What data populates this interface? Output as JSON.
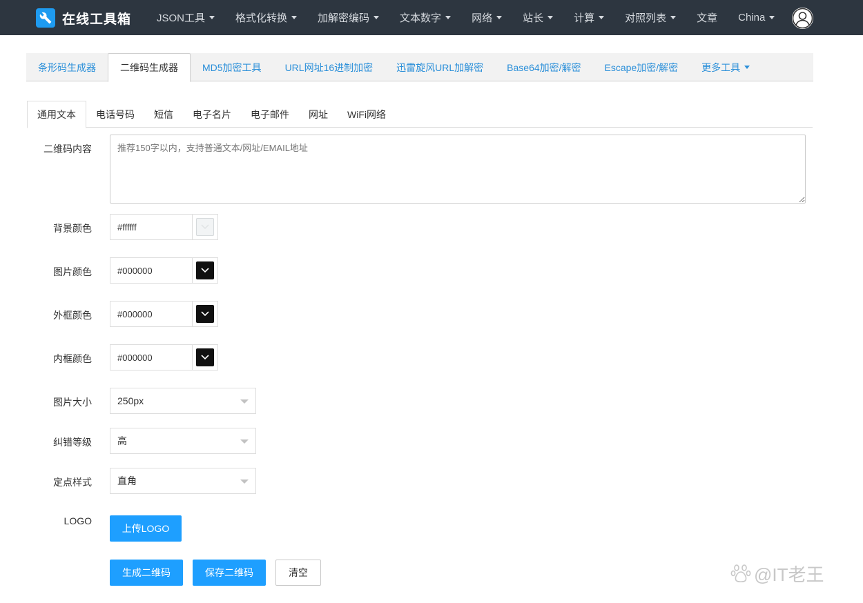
{
  "navbar": {
    "brand": "在线工具箱",
    "items": [
      {
        "label": "JSON工具",
        "dropdown": true
      },
      {
        "label": "格式化转换",
        "dropdown": true
      },
      {
        "label": "加解密编码",
        "dropdown": true
      },
      {
        "label": "文本数字",
        "dropdown": true
      },
      {
        "label": "网络",
        "dropdown": true
      },
      {
        "label": "站长",
        "dropdown": true
      },
      {
        "label": "计算",
        "dropdown": true
      },
      {
        "label": "对照列表",
        "dropdown": true
      },
      {
        "label": "文章",
        "dropdown": false
      },
      {
        "label": "China",
        "dropdown": true
      }
    ]
  },
  "main_tabs": [
    {
      "label": "条形码生成器",
      "active": false
    },
    {
      "label": "二维码生成器",
      "active": true
    },
    {
      "label": "MD5加密工具",
      "active": false
    },
    {
      "label": "URL网址16进制加密",
      "active": false
    },
    {
      "label": "迅雷旋风URL加解密",
      "active": false
    },
    {
      "label": "Base64加密/解密",
      "active": false
    },
    {
      "label": "Escape加密/解密",
      "active": false
    },
    {
      "label": "更多工具",
      "active": false,
      "dropdown": true
    }
  ],
  "sub_tabs": [
    {
      "label": "通用文本",
      "active": true
    },
    {
      "label": "电话号码",
      "active": false
    },
    {
      "label": "短信",
      "active": false
    },
    {
      "label": "电子名片",
      "active": false
    },
    {
      "label": "电子邮件",
      "active": false
    },
    {
      "label": "网址",
      "active": false
    },
    {
      "label": "WiFi网络",
      "active": false
    }
  ],
  "form": {
    "content_label": "二维码内容",
    "content_placeholder": "推荐150字以内，支持普通文本/网址/EMAIL地址",
    "bg_color_label": "背景颜色",
    "bg_color_value": "#ffffff",
    "img_color_label": "图片颜色",
    "img_color_value": "#000000",
    "outer_color_label": "外框颜色",
    "outer_color_value": "#000000",
    "inner_color_label": "内框颜色",
    "inner_color_value": "#000000",
    "size_label": "图片大小",
    "size_value": "250px",
    "level_label": "纠错等级",
    "level_value": "高",
    "dot_label": "定点样式",
    "dot_value": "直角",
    "logo_label": "LOGO",
    "upload_logo": "上传LOGO",
    "generate": "生成二维码",
    "save": "保存二维码",
    "clear": "清空"
  },
  "watermark": {
    "text": "@IT老王"
  },
  "colors": {
    "navbar_bg": "#2d3640",
    "primary": "#1e9fff",
    "link": "#2a8fd9"
  }
}
